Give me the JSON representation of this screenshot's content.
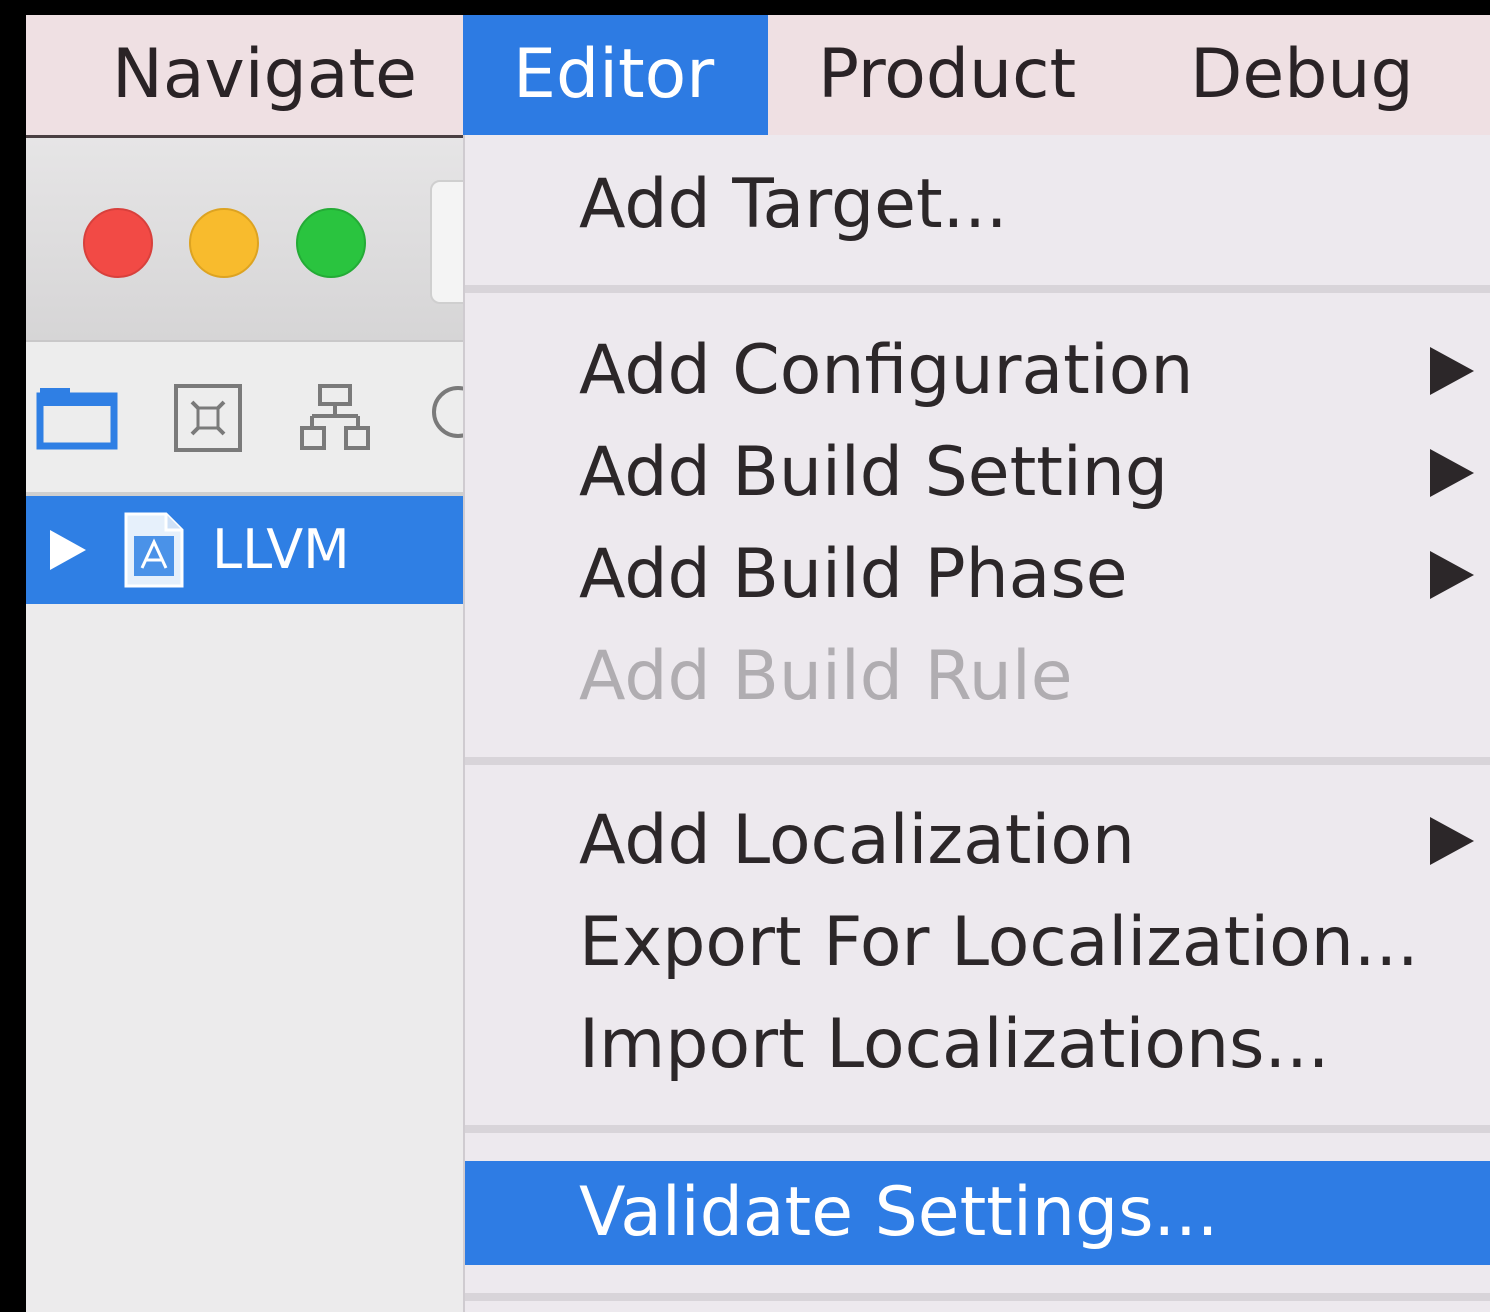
{
  "menubar": {
    "items": [
      {
        "label": "Navigate",
        "active": false
      },
      {
        "label": "Editor",
        "active": true
      },
      {
        "label": "Product",
        "active": false
      },
      {
        "label": "Debug",
        "active": false
      }
    ]
  },
  "window": {
    "traffic_lights": [
      "close",
      "minimize",
      "zoom"
    ],
    "nav_icons": [
      "folder-icon",
      "source-control-icon",
      "hierarchy-icon",
      "search-icon"
    ],
    "tree": {
      "label": "LLVM"
    }
  },
  "editor_menu": {
    "items": [
      {
        "label": "Add Target...",
        "submenu": false,
        "enabled": true
      },
      {
        "label": "Add Configuration",
        "submenu": true,
        "enabled": true
      },
      {
        "label": "Add Build Setting",
        "submenu": true,
        "enabled": true
      },
      {
        "label": "Add Build Phase",
        "submenu": true,
        "enabled": true
      },
      {
        "label": "Add Build Rule",
        "submenu": false,
        "enabled": false
      },
      {
        "label": "Add Localization",
        "submenu": true,
        "enabled": true
      },
      {
        "label": "Export For Localization...",
        "submenu": false,
        "enabled": true
      },
      {
        "label": "Import Localizations...",
        "submenu": false,
        "enabled": true
      },
      {
        "label": "Validate Settings...",
        "submenu": false,
        "enabled": true,
        "highlighted": true
      }
    ]
  },
  "colors": {
    "accent": "#2e7ce4",
    "close": "#f24a45",
    "minimize": "#f8bb2d",
    "zoom": "#2ac43f"
  }
}
